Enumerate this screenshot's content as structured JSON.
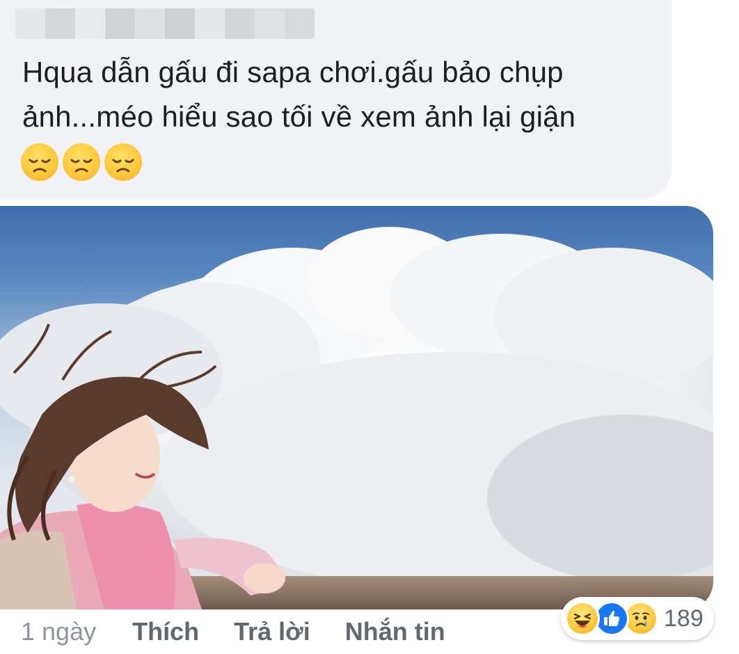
{
  "comment": {
    "author_name": "",
    "text": "Hqua dẫn gấu đi sapa chơi.gấu bảo chụp ảnh...méo hiểu sao tối về xem ảnh lại giận",
    "emojis": [
      "disappointed-face",
      "disappointed-face",
      "disappointed-face"
    ]
  },
  "actions": {
    "time": "1 ngày",
    "like_label": "Thích",
    "reply_label": "Trả lời",
    "message_label": "Nhắn tin"
  },
  "reactions": {
    "types": [
      "haha",
      "like",
      "sad"
    ],
    "count": "189"
  },
  "colors": {
    "bubble_bg": "#f1f2f6",
    "text": "#1c1e21",
    "action_text": "#606770",
    "time_text": "#8d949e",
    "like_blue": "#1877f2"
  }
}
